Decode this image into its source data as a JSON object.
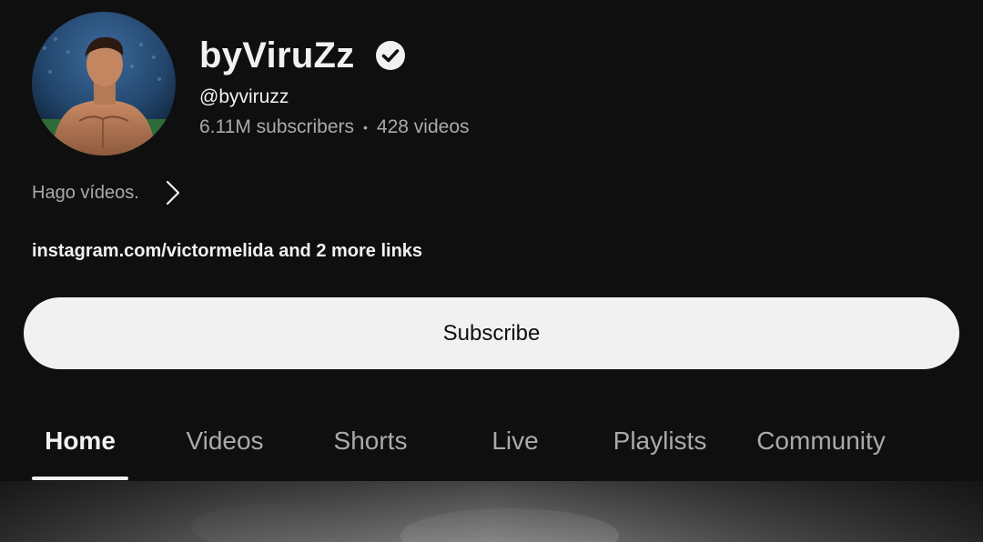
{
  "channel": {
    "name": "byViruZz",
    "handle": "@byviruzz",
    "subscribers": "6.11M subscribers",
    "separator": "•",
    "videos": "428 videos",
    "description": "Hago vídeos.",
    "links": "instagram.com/victormelida and 2 more links"
  },
  "actions": {
    "subscribe_label": "Subscribe"
  },
  "tabs": [
    {
      "label": "Home",
      "active": true
    },
    {
      "label": "Videos",
      "active": false
    },
    {
      "label": "Shorts",
      "active": false
    },
    {
      "label": "Live",
      "active": false
    },
    {
      "label": "Playlists",
      "active": false
    },
    {
      "label": "Community",
      "active": false
    }
  ],
  "icons": {
    "verified": "verified-check-icon",
    "description_chevron": "chevron-right-icon"
  },
  "colors": {
    "background": "#0f0f0f",
    "text_primary": "#f1f1f1",
    "text_secondary": "#aaaaaa",
    "subscribe_bg": "#f1f1f1",
    "subscribe_text": "#0f0f0f"
  }
}
